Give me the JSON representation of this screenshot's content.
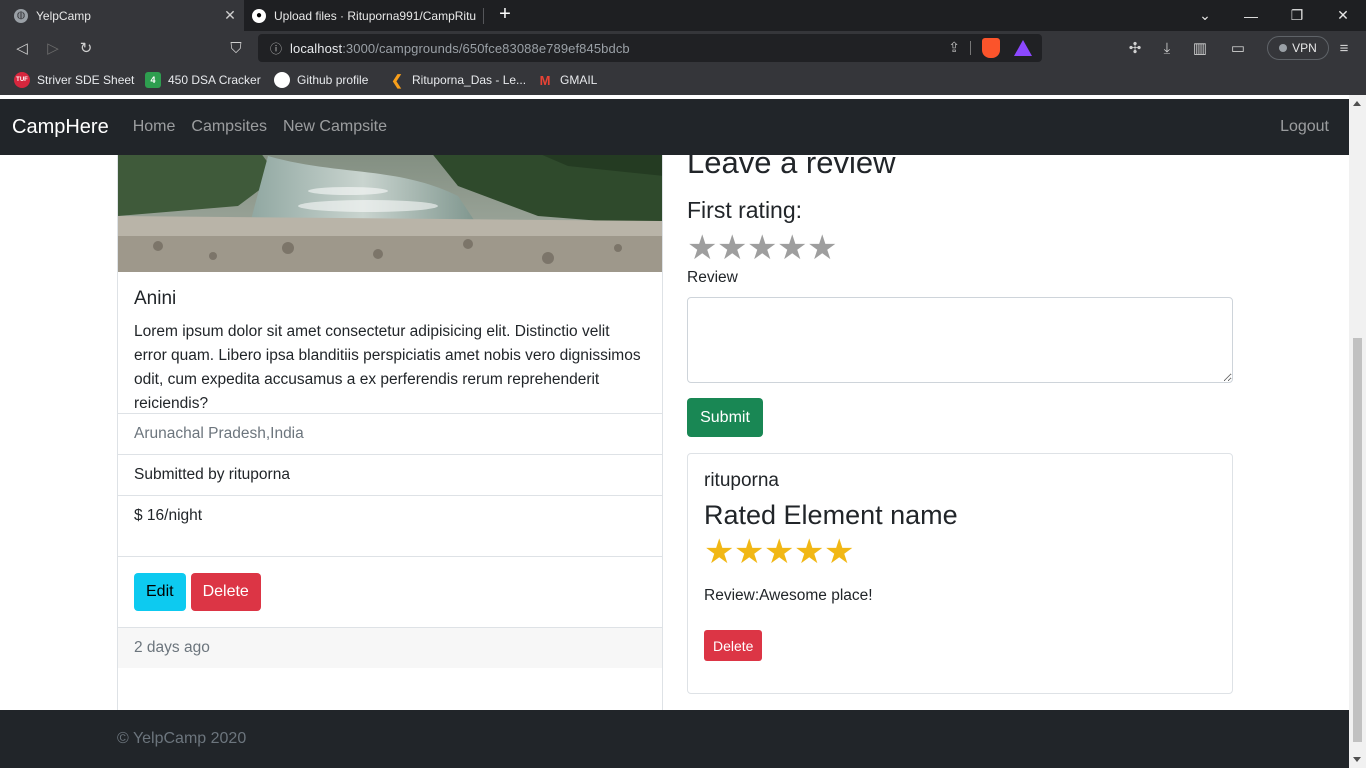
{
  "browser": {
    "tabs": [
      {
        "title": "YelpCamp",
        "active": true
      },
      {
        "title": "Upload files · Rituporna991/CampRitu",
        "active": false
      }
    ],
    "url_host": "localhost",
    "url_rest": ":3000/campgrounds/650fce83088e789ef845bdcb",
    "vpn_label": "VPN",
    "bookmarks": [
      {
        "label": "Striver SDE Sheet",
        "icon": "tuf-icon",
        "badge": "TUF"
      },
      {
        "label": "450 DSA Cracker",
        "icon": "dsa-icon",
        "badge": "4"
      },
      {
        "label": "Github profile",
        "icon": "github-icon",
        "badge": ""
      },
      {
        "label": "Rituporna_Das - Le...",
        "icon": "leetcode-icon",
        "badge": ""
      },
      {
        "label": "GMAIL",
        "icon": "gmail-icon",
        "badge": "M"
      }
    ]
  },
  "navbar": {
    "brand": "CampHere",
    "links": [
      "Home",
      "Campsites",
      "New Campsite"
    ],
    "logout": "Logout"
  },
  "campground": {
    "title": "Anini",
    "description": "Lorem ipsum dolor sit amet consectetur adipisicing elit. Distinctio velit error quam. Libero ipsa blanditiis perspiciatis amet nobis vero dignissimos odit, cum expedita accusamus a ex perferendis rerum reprehenderit reiciendis?",
    "location": "Arunachal Pradesh,India",
    "submitted_by": "Submitted by rituporna",
    "price": "$ 16/night",
    "edit_label": "Edit",
    "delete_label": "Delete",
    "footer": "2 days ago"
  },
  "review_form": {
    "heading": "Leave a review",
    "rating_label": "First rating:",
    "review_label": "Review",
    "submit_label": "Submit"
  },
  "review": {
    "author": "rituporna",
    "rated_text": "Rated Element name",
    "rating": 5,
    "body": "Review:Awesome place!",
    "delete_label": "Delete"
  },
  "footer": {
    "text": "© YelpCamp 2020"
  },
  "colors": {
    "navbar": "#212529",
    "success": "#198754",
    "danger": "#dc3545",
    "info": "#0dcaf0",
    "star": "#f1b715"
  }
}
